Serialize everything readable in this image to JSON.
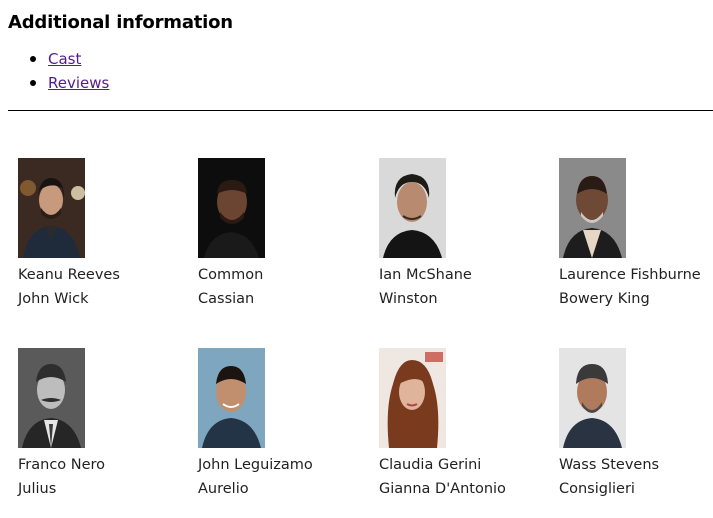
{
  "section": {
    "title": "Additional information"
  },
  "links": [
    {
      "label": "Cast"
    },
    {
      "label": "Reviews"
    }
  ],
  "cast": [
    {
      "actor": "Keanu Reeves",
      "character": "John Wick"
    },
    {
      "actor": "Common",
      "character": "Cassian"
    },
    {
      "actor": "Ian McShane",
      "character": "Winston"
    },
    {
      "actor": "Laurence Fishburne",
      "character": "Bowery King"
    },
    {
      "actor": "Franco Nero",
      "character": "Julius"
    },
    {
      "actor": "John Leguizamo",
      "character": "Aurelio"
    },
    {
      "actor": "Claudia Gerini",
      "character": "Gianna D'Antonio"
    },
    {
      "actor": "Wass Stevens",
      "character": "Consiglieri"
    }
  ],
  "colors": {
    "link_visited": "#551a8b",
    "text": "#222222",
    "divider": "#000000"
  }
}
